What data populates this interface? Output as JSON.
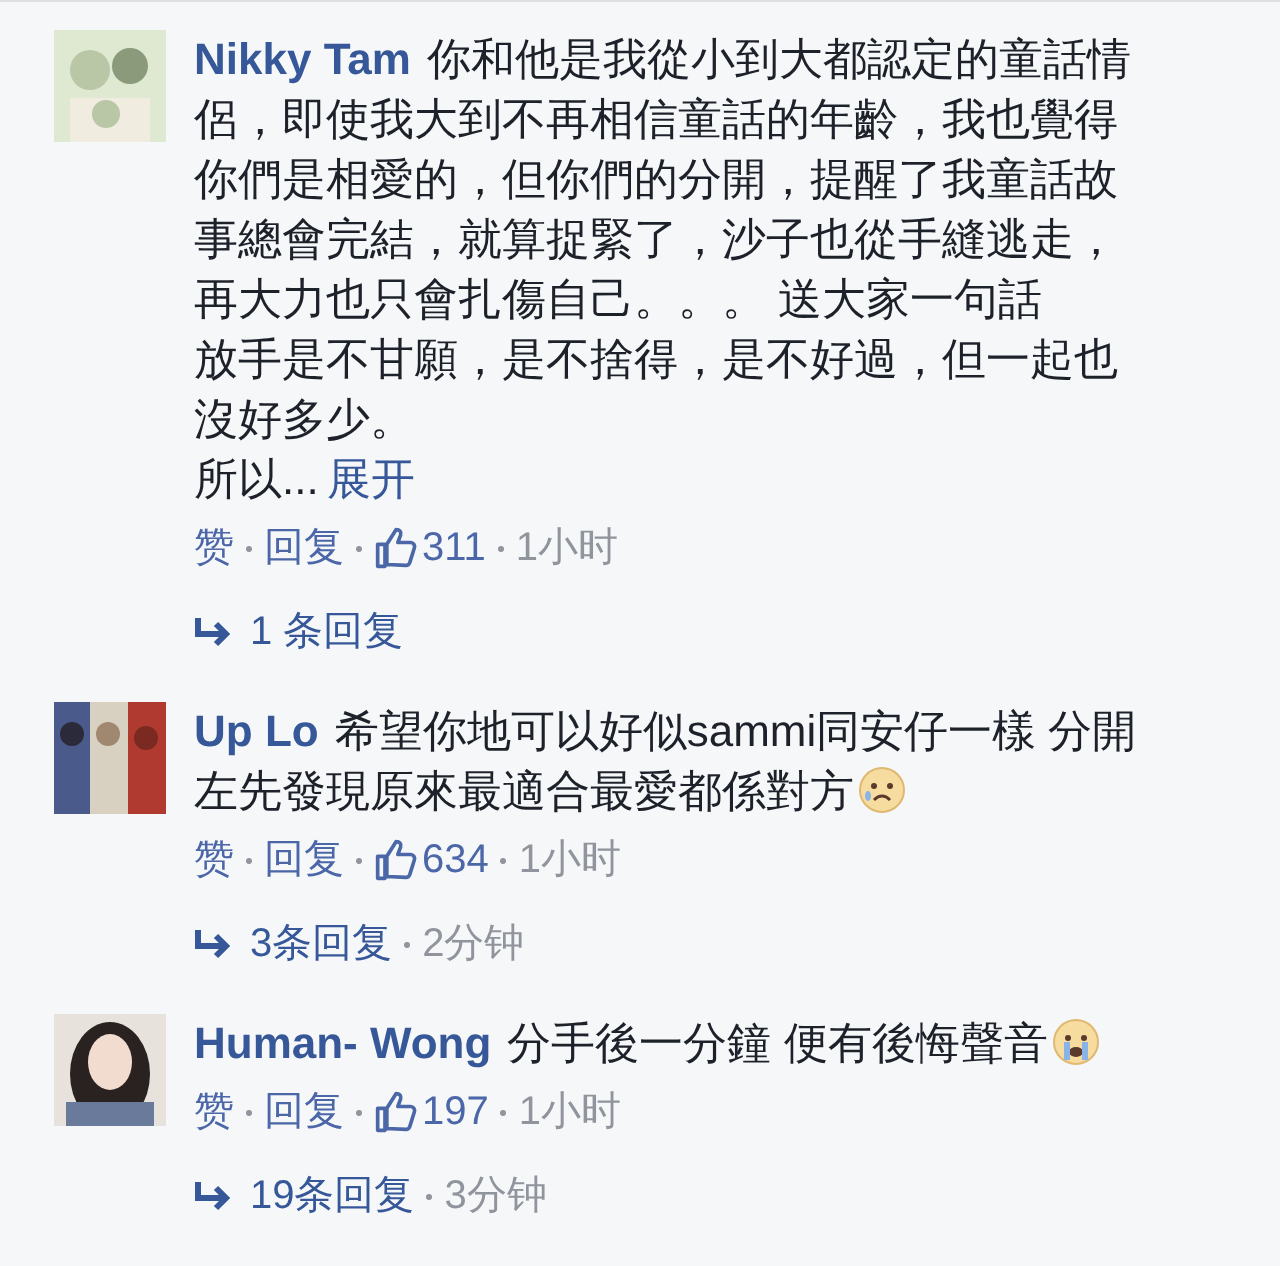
{
  "comments": [
    {
      "name": "Nikky Tam",
      "text": "你和他是我從小到大都認定的童話情侶，即使我大到不再相信童話的年齡，我也覺得你們是相愛的，但你們的分開，提醒了我童話故事總會完結，就算捉緊了，沙子也從手縫逃走，再大力也只會扎傷自己。。。 送大家一句話",
      "more_lines": [
        "放手是不甘願，是不捨得，是不好過，但一起也沒好多少。",
        "所以..."
      ],
      "more_link": "展开",
      "like": "赞",
      "reply": "回复",
      "likes": "311",
      "time": "1小时",
      "replies": {
        "count": "1 条回复"
      }
    },
    {
      "name": "Up Lo",
      "text": "希望你地可以好似sammi同安仔一樣 分開左先發現原來最適合最愛都係對方",
      "kind": "sad-emoji",
      "like": "赞",
      "reply": "回复",
      "likes": "634",
      "time": "1小时",
      "replies": {
        "count": "3条回复",
        "time": "2分钟"
      }
    },
    {
      "name": "Human- Wong",
      "text": "分手後一分鐘 便有後悔聲音",
      "kind": "crying-emoji",
      "like": "赞",
      "reply": "回复",
      "likes": "197",
      "time": "1小时",
      "replies": {
        "count": "19条回复",
        "time": "3分钟"
      }
    }
  ]
}
